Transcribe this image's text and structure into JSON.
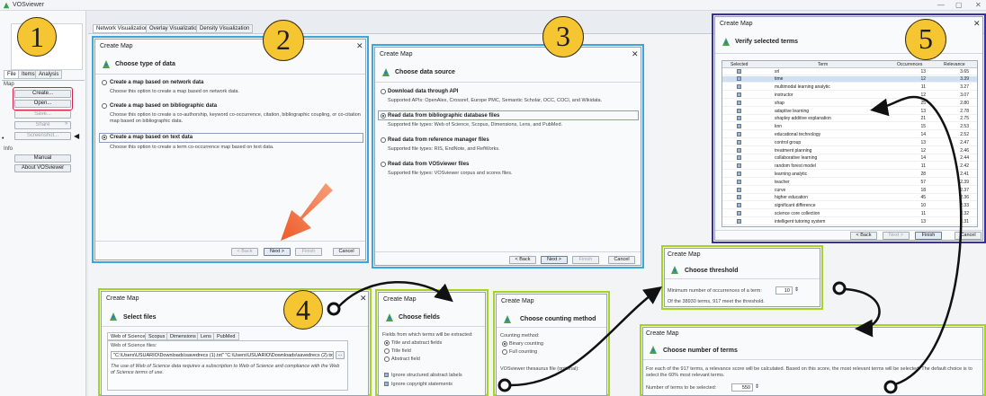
{
  "app": {
    "title": "VOSviewer"
  },
  "left_tabs": [
    "File",
    "Items",
    "Analysis"
  ],
  "left_sections": {
    "map": "Map",
    "info": "Info"
  },
  "left_buttons": {
    "create": "Create...",
    "open": "Open...",
    "save": "Save...",
    "share": "Share",
    "screenshot": "Screenshot...",
    "manual": "Manual",
    "about": "About VOSviewer"
  },
  "viz_tabs": [
    "Network Visualization",
    "Overlay Visualization",
    "Density Visualization"
  ],
  "steps": [
    "1",
    "2",
    "3",
    "4",
    "5"
  ],
  "dlg2": {
    "title": "Create Map",
    "header": "Choose type of data",
    "options": [
      {
        "label": "Create a map based on network data",
        "desc": "Choose this option to create a map based on network data."
      },
      {
        "label": "Create a map based on bibliographic data",
        "desc": "Choose this option to create a co-authorship, keyword co-occurrence, citation, bibliographic coupling, or co-citation map based on bibliographic data."
      },
      {
        "label": "Create a map based on text data",
        "desc": "Choose this option to create a term co-occurrence map based on text data."
      }
    ],
    "buttons": {
      "back": "< Back",
      "next": "Next >",
      "finish": "Finish",
      "cancel": "Cancel"
    }
  },
  "dlg3": {
    "title": "Create Map",
    "header": "Choose data source",
    "options": [
      {
        "label": "Download data through API",
        "desc": "Supported APIs: OpenAlex, Crossref, Europe PMC, Semantic Scholar, OCC, COCI, and Wikidata."
      },
      {
        "label": "Read data from bibliographic database files",
        "desc": "Supported file types: Web of Science, Scopus, Dimensions, Lens, and PubMed."
      },
      {
        "label": "Read data from reference manager files",
        "desc": "Supported file types: RIS, EndNote, and RefWorks."
      },
      {
        "label": "Read data from VOSviewer files",
        "desc": "Supported file types: VOSviewer corpus and scores files."
      }
    ],
    "buttons": {
      "back": "< Back",
      "next": "Next >",
      "finish": "Finish",
      "cancel": "Cancel"
    }
  },
  "dlg5": {
    "title": "Create Map",
    "header": "Verify selected terms",
    "columns": [
      "Selected",
      "Term",
      "Occurrences",
      "Relevance"
    ],
    "rows": [
      {
        "term": "srl",
        "occ": "13",
        "rel": "3.65"
      },
      {
        "term": "time",
        "occ": "12",
        "rel": "3.39"
      },
      {
        "term": "multimodal learning analytic",
        "occ": "11",
        "rel": "3.27"
      },
      {
        "term": "instructor",
        "occ": "12",
        "rel": "3.07"
      },
      {
        "term": "shap",
        "occ": "25",
        "rel": "2.80"
      },
      {
        "term": "adaptive learning",
        "occ": "13",
        "rel": "2.78"
      },
      {
        "term": "shapley additive explanation",
        "occ": "21",
        "rel": "2.75"
      },
      {
        "term": "knn",
        "occ": "15",
        "rel": "2.53"
      },
      {
        "term": "educational technology",
        "occ": "14",
        "rel": "2.52"
      },
      {
        "term": "control group",
        "occ": "13",
        "rel": "2.47"
      },
      {
        "term": "treatment planning",
        "occ": "12",
        "rel": "2.46"
      },
      {
        "term": "collaborative learning",
        "occ": "14",
        "rel": "2.44"
      },
      {
        "term": "random forest model",
        "occ": "11",
        "rel": "2.42"
      },
      {
        "term": "learning analytic",
        "occ": "28",
        "rel": "2.41"
      },
      {
        "term": "teacher",
        "occ": "57",
        "rel": "2.39"
      },
      {
        "term": "curve",
        "occ": "18",
        "rel": "2.37"
      },
      {
        "term": "higher education",
        "occ": "45",
        "rel": "2.36"
      },
      {
        "term": "significant difference",
        "occ": "10",
        "rel": "2.33"
      },
      {
        "term": "science core collection",
        "occ": "11",
        "rel": "2.32"
      },
      {
        "term": "intelligent tutoring system",
        "occ": "13",
        "rel": "2.31"
      }
    ],
    "buttons": {
      "back": "< Back",
      "next": "Next >",
      "finish": "Finish",
      "cancel": "Cancel"
    }
  },
  "dlg4": {
    "title": "Create Map",
    "header": "Select files",
    "tabs": [
      "Web of Science",
      "Scopus",
      "Dimensions",
      "Lens",
      "PubMed"
    ],
    "field_label": "Web of Science files:",
    "field_value": "\"C:\\Users\\USUARIO\\Downloads\\savedrecs (1).txt\" \"C:\\Users\\USUARIO\\Downloads\\savedrecs (2).txt\"",
    "note": "The use of Web of Science data requires a subscription to Web of Science and compliance with the Web of Science terms of use."
  },
  "dlg_fields": {
    "title": "Create Map",
    "header": "Choose fields",
    "intro": "Fields from which terms will be extracted:",
    "options": [
      "Title and abstract fields",
      "Title field",
      "Abstract field"
    ],
    "checks": [
      "Ignore structured abstract labels",
      "Ignore copyright statements"
    ]
  },
  "dlg_count": {
    "title": "Create Map",
    "header": "Choose counting method",
    "label": "Counting method:",
    "options": [
      "Binary counting",
      "Full counting"
    ],
    "thesaurus": "VOSviewer thesaurus file (optional):"
  },
  "dlg_threshold": {
    "title": "Create Map",
    "header": "Choose threshold",
    "label": "Minimum number of occurrences of a term:",
    "value": "10",
    "note": "Of the 38930 terms, 917 meet the threshold."
  },
  "dlg_number": {
    "title": "Create Map",
    "header": "Choose number of terms",
    "desc": "For each of the 917 terms, a relevance score will be calculated. Based on this score, the most relevant terms will be selected. The default choice is to select the 60% most relevant terms.",
    "label": "Number of terms to be selected:",
    "value": "550"
  },
  "colors": {
    "step_badge": "#f5c532",
    "blue_frame": "#3ea4de",
    "navy_frame": "#3a2fa0",
    "green_frame": "#a7d324",
    "red_highlight": "#d61f4a",
    "arrow": "#f06a3a"
  }
}
